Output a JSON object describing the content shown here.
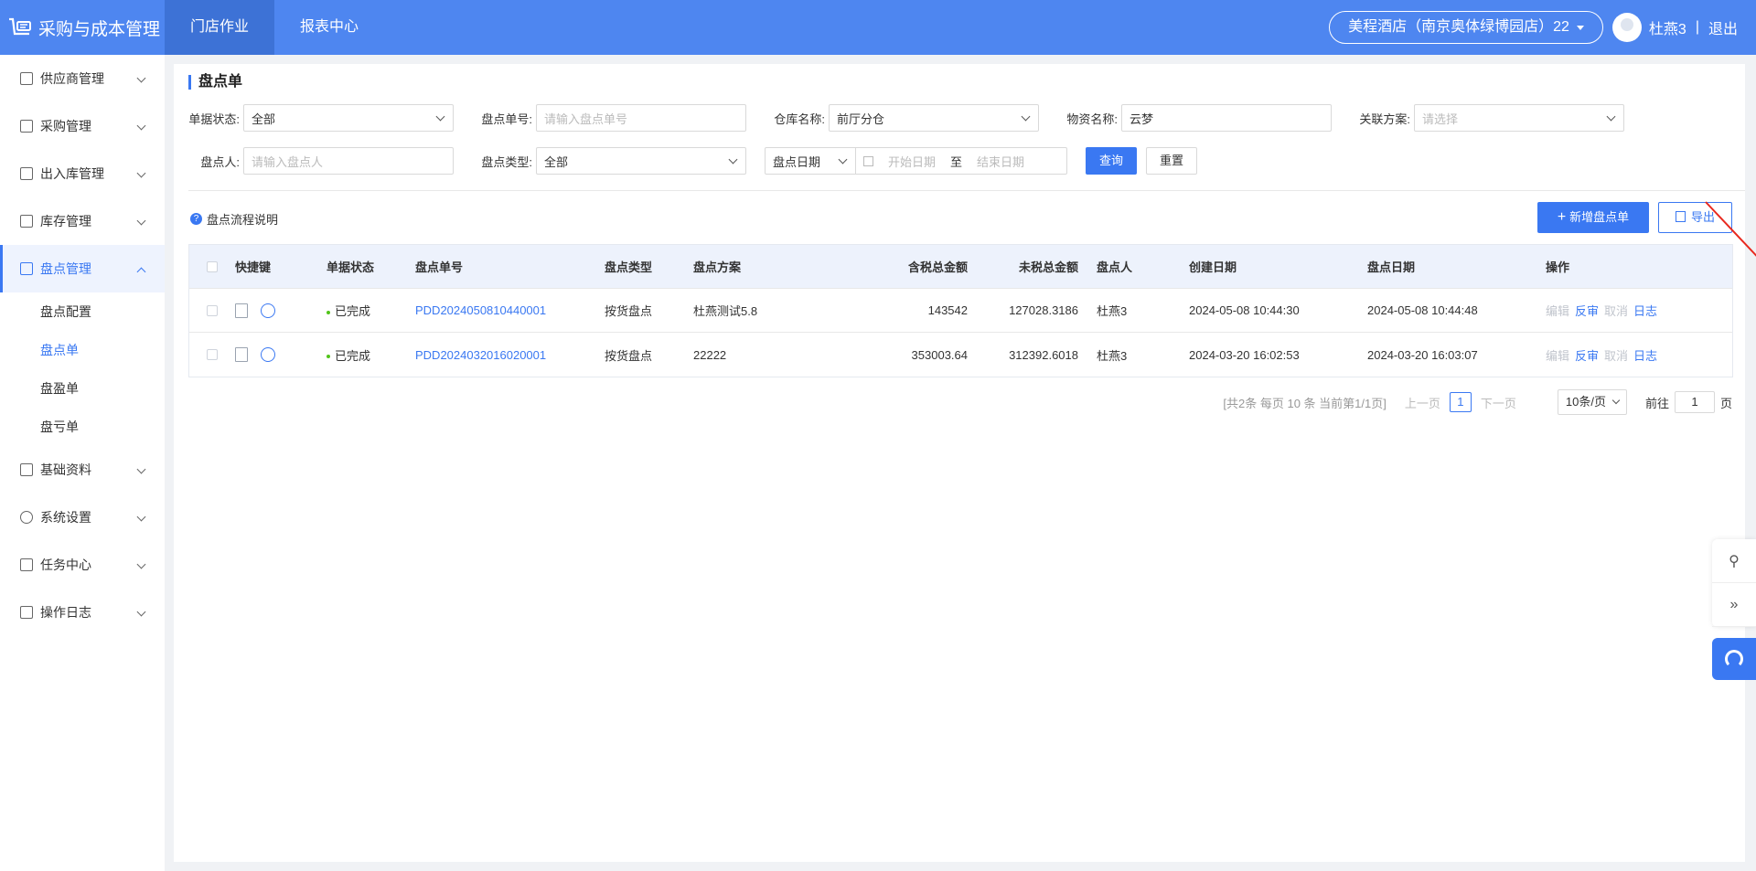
{
  "app": {
    "title": "采购与成本管理"
  },
  "topnav": [
    {
      "label": "门店作业",
      "active": true
    },
    {
      "label": "报表中心",
      "active": false
    }
  ],
  "header": {
    "store": "美程酒店（南京奥体绿博园店）22",
    "user": "杜燕3",
    "separator": "|",
    "logout": "退出"
  },
  "sidebar": {
    "items": [
      {
        "label": "供应商管理",
        "icon": "supplier-icon"
      },
      {
        "label": "采购管理",
        "icon": "purchase-icon"
      },
      {
        "label": "出入库管理",
        "icon": "inout-icon"
      },
      {
        "label": "库存管理",
        "icon": "inventory-icon"
      },
      {
        "label": "盘点管理",
        "icon": "stocktake-icon",
        "open": true
      },
      {
        "label": "基础资料",
        "icon": "basic-data-icon"
      },
      {
        "label": "系统设置",
        "icon": "gear-icon"
      },
      {
        "label": "任务中心",
        "icon": "task-icon"
      },
      {
        "label": "操作日志",
        "icon": "log-icon"
      }
    ],
    "sub_items": [
      {
        "label": "盘点配置"
      },
      {
        "label": "盘点单",
        "active": true
      },
      {
        "label": "盘盈单"
      },
      {
        "label": "盘亏单"
      }
    ]
  },
  "page": {
    "title": "盘点单",
    "help": "盘点流程说明"
  },
  "filters": {
    "status_label": "单据状态:",
    "status_value": "全部",
    "order_no_label": "盘点单号:",
    "order_no_placeholder": "请输入盘点单号",
    "warehouse_label": "仓库名称:",
    "warehouse_value": "前厅分仓",
    "material_label": "物资名称:",
    "material_value": "云梦",
    "plan_label": "关联方案:",
    "plan_placeholder": "请选择",
    "person_label": "盘点人:",
    "person_placeholder": "请输入盘点人",
    "type_label": "盘点类型:",
    "type_value": "全部",
    "date_type": "盘点日期",
    "start_placeholder": "开始日期",
    "range_sep": "至",
    "end_placeholder": "结束日期",
    "query": "查询",
    "reset": "重置"
  },
  "actions": {
    "add": "新增盘点单",
    "export": "导出"
  },
  "table": {
    "headers": [
      "快捷键",
      "单据状态",
      "盘点单号",
      "盘点类型",
      "盘点方案",
      "含税总金额",
      "未税总金额",
      "盘点人",
      "创建日期",
      "盘点日期",
      "操作"
    ],
    "rows": [
      {
        "status": "已完成",
        "order_no": "PDD2024050810440001",
        "type": "按货盘点",
        "plan": "杜燕测试5.8",
        "tax_amount": "143542",
        "net_amount": "127028.3186",
        "person": "杜燕3",
        "created": "2024-05-08 10:44:30",
        "stock_date": "2024-05-08 10:44:48",
        "ops": [
          "编辑",
          "反审",
          "取消",
          "日志"
        ]
      },
      {
        "status": "已完成",
        "order_no": "PDD2024032016020001",
        "type": "按货盘点",
        "plan": "22222",
        "tax_amount": "353003.64",
        "net_amount": "312392.6018",
        "person": "杜燕3",
        "created": "2024-03-20 16:02:53",
        "stock_date": "2024-03-20 16:03:07",
        "ops": [
          "编辑",
          "反审",
          "取消",
          "日志"
        ]
      }
    ]
  },
  "pagination": {
    "info": "[共2条 每页 10 条 当前第1/1页]",
    "prev": "上一页",
    "page": "1",
    "next": "下一页",
    "size": "10条/页",
    "goto": "前往",
    "goto_value": "1",
    "unit": "页"
  },
  "colors": {
    "primary": "#3a78f2",
    "topbar": "#4e86f0",
    "arrow": "#e8281e"
  }
}
